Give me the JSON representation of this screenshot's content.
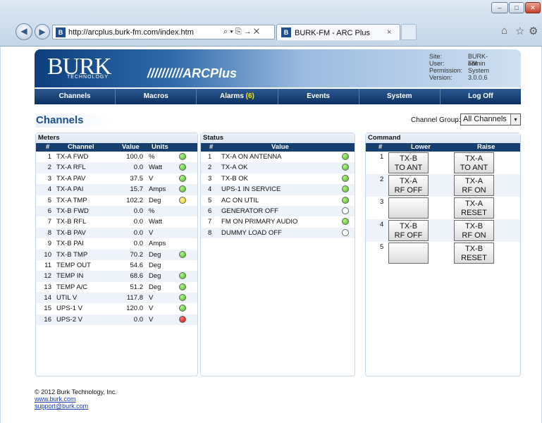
{
  "browser": {
    "url": "http://arcplus.burk-fm.com/index.htm",
    "address_tools": "⌕ ▾ ⎘ → ✕",
    "tab_title": "BURK-FM - ARC Plus",
    "tab_close": "×",
    "favicon": "B",
    "back_glyph": "◀",
    "fwd_glyph": "▶",
    "min_glyph": "–",
    "max_glyph": "□",
    "close_glyph": "✕",
    "home_glyph": "⌂",
    "star_glyph": "☆",
    "gear_glyph": "⚙"
  },
  "header": {
    "logo": "BURK",
    "logo_sub": "TECHNOLOGY",
    "product": "//////////ARCPlus",
    "info": [
      {
        "k": "Site:",
        "v": "BURK-FM"
      },
      {
        "k": "User:",
        "v": "admin"
      },
      {
        "k": "Permission:",
        "v": "System"
      },
      {
        "k": "Version:",
        "v": "3.0.0.6"
      }
    ]
  },
  "menu": {
    "channels": "Channels",
    "macros": "Macros",
    "alarms": "Alarms",
    "alarms_count": "(6)",
    "events": "Events",
    "system": "System",
    "logoff": "Log Off"
  },
  "page_title": "Channels",
  "channel_group": {
    "label": "Channel Group:",
    "value": "All Channels",
    "arrow": "▾"
  },
  "meters": {
    "title": "Meters",
    "headers": {
      "num": "#",
      "channel": "Channel",
      "value": "Value",
      "units": "Units"
    },
    "rows": [
      {
        "num": "1",
        "channel": "TX-A FWD",
        "value": "100.0",
        "units": "%",
        "led": "green"
      },
      {
        "num": "2",
        "channel": "TX-A RFL",
        "value": "0.0",
        "units": "Watt",
        "led": "green"
      },
      {
        "num": "3",
        "channel": "TX-A PAV",
        "value": "37.5",
        "units": "V",
        "led": "green"
      },
      {
        "num": "4",
        "channel": "TX-A PAI",
        "value": "15.7",
        "units": "Amps",
        "led": "green"
      },
      {
        "num": "5",
        "channel": "TX-A TMP",
        "value": "102.2",
        "units": "Deg",
        "led": "yellow"
      },
      {
        "num": "6",
        "channel": "TX-B FWD",
        "value": "0.0",
        "units": "%",
        "led": "none"
      },
      {
        "num": "7",
        "channel": "TX-B RFL",
        "value": "0.0",
        "units": "Watt",
        "led": "none"
      },
      {
        "num": "8",
        "channel": "TX-B PAV",
        "value": "0.0",
        "units": "V",
        "led": "none"
      },
      {
        "num": "9",
        "channel": "TX-B PAI",
        "value": "0.0",
        "units": "Amps",
        "led": "none"
      },
      {
        "num": "10",
        "channel": "TX-B TMP",
        "value": "70.2",
        "units": "Deg",
        "led": "green"
      },
      {
        "num": "11",
        "channel": "TEMP OUT",
        "value": "54.6",
        "units": "Deg",
        "led": "none"
      },
      {
        "num": "12",
        "channel": "TEMP IN",
        "value": "68.6",
        "units": "Deg",
        "led": "green"
      },
      {
        "num": "13",
        "channel": "TEMP A/C",
        "value": "51.2",
        "units": "Deg",
        "led": "green"
      },
      {
        "num": "14",
        "channel": "UTIL V",
        "value": "117.8",
        "units": "V",
        "led": "green"
      },
      {
        "num": "15",
        "channel": "UPS-1 V",
        "value": "120.0",
        "units": "V",
        "led": "green"
      },
      {
        "num": "16",
        "channel": "UPS-2 V",
        "value": "0.0",
        "units": "V",
        "led": "red"
      }
    ]
  },
  "status": {
    "title": "Status",
    "headers": {
      "num": "#",
      "value": "Value"
    },
    "rows": [
      {
        "num": "1",
        "value": "TX-A ON ANTENNA",
        "led": "green"
      },
      {
        "num": "2",
        "value": "TX-A OK",
        "led": "green"
      },
      {
        "num": "3",
        "value": "TX-B OK",
        "led": "green"
      },
      {
        "num": "4",
        "value": "UPS-1 IN SERVICE",
        "led": "green"
      },
      {
        "num": "5",
        "value": "AC ON UTIL",
        "led": "green"
      },
      {
        "num": "6",
        "value": "GENERATOR OFF",
        "led": "off"
      },
      {
        "num": "7",
        "value": "FM ON PRIMARY AUDIO",
        "led": "green"
      },
      {
        "num": "8",
        "value": "DUMMY LOAD OFF",
        "led": "off"
      }
    ]
  },
  "command": {
    "title": "Command",
    "headers": {
      "num": "#",
      "lower": "Lower",
      "raise": "Raise"
    },
    "rows": [
      {
        "num": "1",
        "lower": [
          "TX-B",
          "TO ANT"
        ],
        "raise": [
          "TX-A",
          "TO ANT"
        ]
      },
      {
        "num": "2",
        "lower": [
          "TX-A",
          "RF OFF"
        ],
        "raise": [
          "TX-A",
          "RF ON"
        ]
      },
      {
        "num": "3",
        "lower": [
          "",
          ""
        ],
        "raise": [
          "TX-A",
          "RESET"
        ]
      },
      {
        "num": "4",
        "lower": [
          "TX-B",
          "RF OFF"
        ],
        "raise": [
          "TX-B",
          "RF ON"
        ]
      },
      {
        "num": "5",
        "lower": [
          "",
          ""
        ],
        "raise": [
          "TX-B",
          "RESET"
        ]
      }
    ]
  },
  "footer": {
    "copyright": "© 2012 Burk Technology, Inc.",
    "link1": "www.burk.com",
    "link2": "support@burk.com"
  }
}
